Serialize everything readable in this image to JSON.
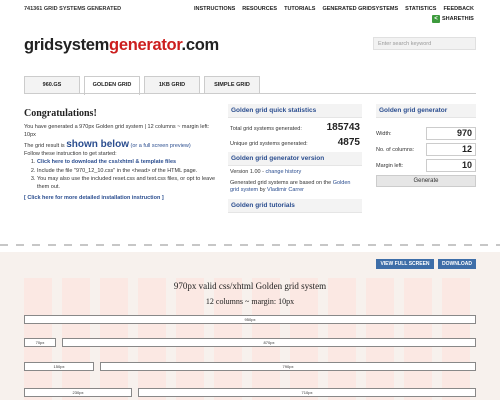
{
  "header": {
    "count": "741361 GRID SYSTEMS GENERATED",
    "nav": [
      "INSTRUCTIONS",
      "RESOURCES",
      "TUTORIALS",
      "GENERATED GRIDSYSTEMS",
      "STATISTICS",
      "FEEDBACK"
    ],
    "share": "SHARETHIS"
  },
  "logo": {
    "part1": "gridsystem",
    "part2": "generator",
    "part3": ".com"
  },
  "search": {
    "placeholder": "Enter search keyword"
  },
  "tabs": [
    "960.GS",
    "GOLDEN GRID",
    "1KB GRID",
    "SIMPLE GRID"
  ],
  "left": {
    "title": "Congratulations!",
    "intro": "You have generated a 970px Golden grid system | 12 columns ~ margin left: 10px",
    "result_pre": "The grid result is ",
    "result_big": "shown below",
    "result_link": " (or a full screen preview)",
    "follow": "Follow these instruction to get started:",
    "steps": [
      "Click here to download the css/xhtml & template files",
      "Include the file \"970_12_10.css\" in the <head> of the HTML page.",
      "You may also use the included reset.css and text.css files, or opt to leave them out."
    ],
    "more": "[ Click here for more detailed installation instruction ]"
  },
  "mid": {
    "stats_title": "Golden grid quick statistics",
    "total_label": "Total grid systems generated:",
    "total_value": "185743",
    "unique_label": "Unique grid systems generated:",
    "unique_value": "4875",
    "version_title": "Golden grid generator version",
    "version_text": "Version 1.00 - ",
    "change_history": "change history",
    "based_text": "Generated grid systems are based on the ",
    "based_link": "Golden grid system",
    "by_text": " by ",
    "author": "Vladimir Carrer",
    "tutorials_title": "Golden grid tutorials"
  },
  "right": {
    "title": "Golden grid generator",
    "width_label": "Width:",
    "width_value": "970",
    "cols_label": "No. of columns:",
    "cols_value": "12",
    "margin_label": "Margin left:",
    "margin_value": "10",
    "generate": "Generate"
  },
  "preview": {
    "view_full": "VIEW FULL SCREEN",
    "download": "DOWNLOAD",
    "title": "970px valid css/xhtml Golden grid system",
    "subtitle": "12 columns ~ margin: 10px",
    "boxes": [
      "950px",
      "70px",
      "870px",
      "150px",
      "790px",
      "230px",
      "710px"
    ]
  },
  "colors": {
    "accent": "#2a4d8f",
    "logo_red": "#cc1e1e",
    "button_blue": "#3e6ea8",
    "grid_bg": "#f7f1ed",
    "grid_col": "#fbe8e3"
  }
}
